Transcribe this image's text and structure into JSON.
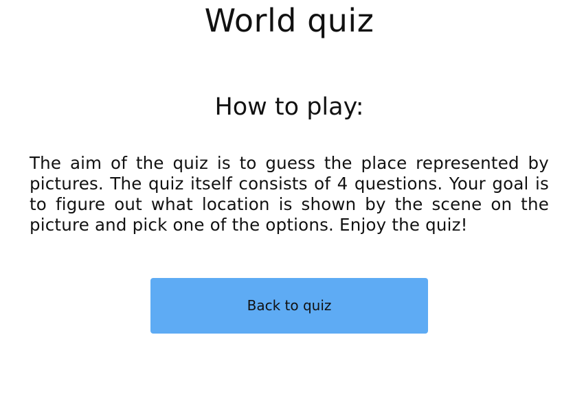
{
  "page": {
    "title": "World quiz",
    "heading": "How to play:",
    "instructions": "The aim of the quiz is to guess the place represented by pictures. The quiz itself consists of 4 questions. Your goal is to figure out what location is shown by the scene on the picture and pick one of the options. Enjoy the quiz!"
  },
  "actions": {
    "back_label": "Back to quiz"
  },
  "colors": {
    "button_background": "#5eabf4",
    "text": "#111111",
    "background": "#ffffff"
  }
}
